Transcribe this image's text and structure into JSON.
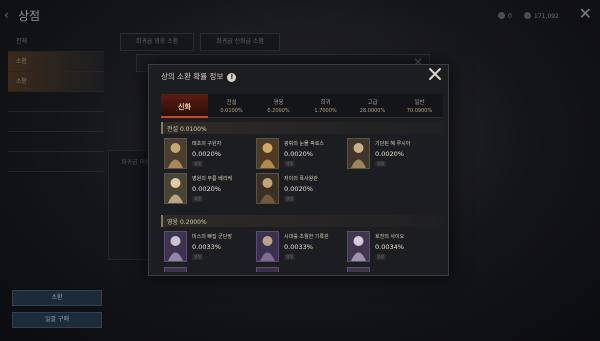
{
  "background": {
    "title": "상점",
    "back_glyph": "‹",
    "resource_1": "0",
    "resource_2": "171,092",
    "close_glyph": "✕",
    "sidebar_items": [
      "전체",
      "소환",
      "소환",
      "",
      "",
      "",
      ""
    ],
    "tabs": [
      "희귀급 영웅 소환",
      "희귀급 신화급 소환"
    ],
    "left_panel_label": "희귀급 이상",
    "buttons": [
      "소환",
      "일괄 구매"
    ]
  },
  "popup": {
    "title": "상의 소환 확률 정보",
    "info_glyph": "!",
    "grades": [
      {
        "name": "신화",
        "rate": "",
        "active": true
      },
      {
        "name": "전설",
        "rate": "0.0100%"
      },
      {
        "name": "영웅",
        "rate": "0.2000%"
      },
      {
        "name": "희귀",
        "rate": "1.7000%"
      },
      {
        "name": "고급",
        "rate": "28.0000%"
      },
      {
        "name": "일반",
        "rate": "70.0900%"
      }
    ],
    "sections": [
      {
        "label": "전설  0.0100%",
        "items": [
          {
            "name": "태초의 구원자",
            "rate": "0.0020%",
            "badge": "영웅"
          },
          {
            "name": "광휘의 눈물 픽로스",
            "rate": "0.0020%",
            "badge": "영웅"
          },
          {
            "name": "기던된 혜 루시아",
            "rate": "0.0020%",
            "badge": "영웅"
          },
          {
            "name": "영원의 무릎 베리케",
            "rate": "0.0020%",
            "badge": "영웅"
          },
          {
            "name": "저이의 폭사왕관",
            "rate": "0.0020%",
            "badge": "영웅"
          }
        ]
      },
      {
        "label": "영웅  0.2000%",
        "items": [
          {
            "name": "미스의 빠집 군단장",
            "rate": "0.0033%",
            "badge": "영웅"
          },
          {
            "name": "시대를 초월한 기록관",
            "rate": "0.0033%",
            "badge": "영웅"
          },
          {
            "name": "호천의 사이오",
            "rate": "0.0034%",
            "badge": "영웅"
          }
        ]
      }
    ]
  },
  "colors": {
    "accent": "#c2452c",
    "gold": "#b8a47e",
    "panel": "#1c1d21"
  }
}
